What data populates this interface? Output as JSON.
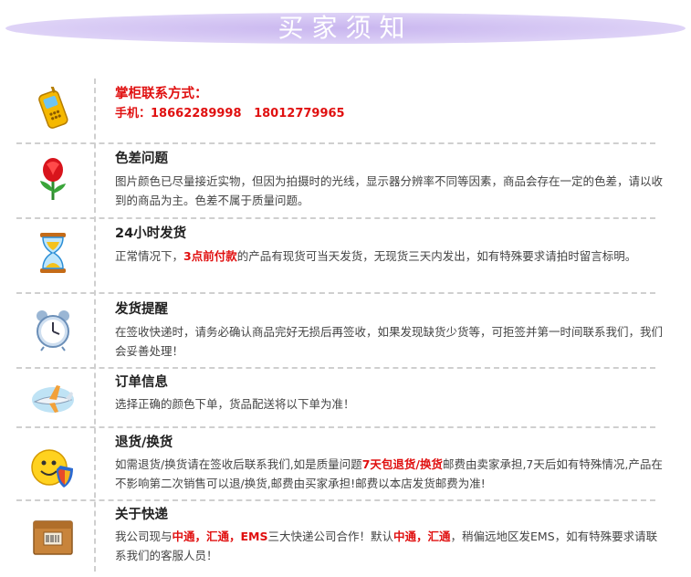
{
  "banner": {
    "title": "买家须知"
  },
  "contact": {
    "title": "掌柜联系方式：",
    "phone_label": "手机：",
    "phone1": "18662289998",
    "phone2": "18012779965"
  },
  "color_diff": {
    "title": "色差问题",
    "body": "图片颜色已尽量接近实物，但因为拍摄时的光线，显示器分辨率不同等因素，商品会存在一定的色差，请以收到的商品为主。色差不属于质量问题。"
  },
  "shipping24": {
    "title": "24小时发货",
    "body_a": "正常情况下，",
    "body_hl": "3点前付款",
    "body_b": "的产品有现货可当天发货，无现货三天内发出，如有特殊要求请拍时留言标明。"
  },
  "reminder": {
    "title": "发货提醒",
    "body": "在签收快递时，请务必确认商品完好无损后再签收，如果发现缺货少货等，可拒签并第一时间联系我们，我们会妥善处理！"
  },
  "order": {
    "title": "订单信息",
    "body": "选择正确的颜色下单，货品配送将以下单为准！"
  },
  "returns": {
    "title": "退货/换货",
    "body_a": "如需退货/换货请在签收后联系我们,如是质量问题",
    "body_hl": "7天包退货/换货",
    "body_b": "邮费由卖家承担,7天后如有特殊情况,产品在不影响第二次销售可以退/换货,邮费由买家承担!邮费以本店发货邮费为准!"
  },
  "express": {
    "title": "关于快递",
    "body_a": "我公司现与",
    "body_hl1": "中通，汇通，EMS",
    "body_b": "三大快递公司合作！默认",
    "body_hl2": "中通，汇通",
    "body_c": "，稍偏远地区发EMS，如有特殊要求请联系我们的客服人员！"
  },
  "icons": {
    "phone": "mobile-phone-icon",
    "rose": "rose-icon",
    "hourglass": "hourglass-icon",
    "clock": "alarm-clock-icon",
    "plane": "airplane-icon",
    "smiley": "smiley-shield-icon",
    "box": "parcel-box-icon"
  }
}
